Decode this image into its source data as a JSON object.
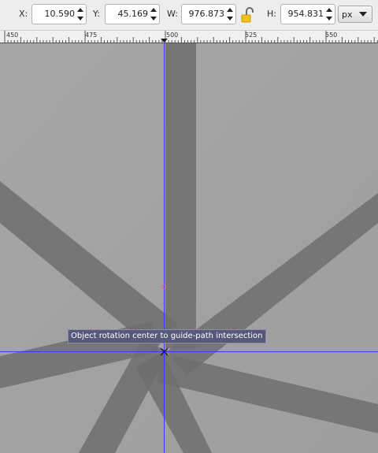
{
  "toolbar": {
    "x": {
      "label": "X:",
      "value": "10.590"
    },
    "y": {
      "label": "Y:",
      "value": "45.169"
    },
    "w": {
      "label": "W:",
      "value": "976.873"
    },
    "h": {
      "label": "H:",
      "value": "954.831"
    },
    "lock_icon": "unlocked-padlock-icon",
    "unit": "px"
  },
  "ruler": {
    "labels": [
      "450",
      "475",
      "500",
      "525",
      "550"
    ]
  },
  "canvas": {
    "background_color": "#a3a3a3",
    "stroke_color": "#6e6e6e",
    "guide_color": "#3a3aff",
    "rotation_center_color": "#d4607a"
  },
  "tooltip": {
    "text": "Object rotation center to guide-path intersection"
  }
}
